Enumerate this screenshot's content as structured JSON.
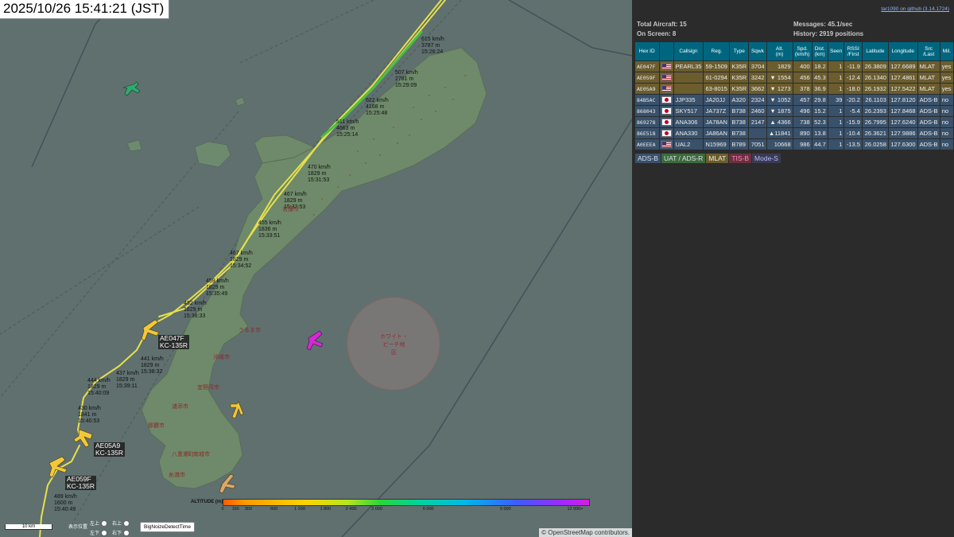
{
  "map": {
    "clock": "2025/10/26 15:41:21 (JST)",
    "attribution": "© OpenStreetMap contributors.",
    "scale_label": "10 km",
    "legend_title": "ALTITUDE (m)",
    "legend_ticks": [
      "0",
      "150",
      "300",
      "600",
      "1 200",
      "1 800",
      "2 400",
      "3 000",
      "6 000",
      "9 000",
      "12 000+"
    ],
    "zone_label": "ホワイト・\nビーチ地\n区",
    "place_labels": [
      "うるま市",
      "沖縄市",
      "宜野湾市",
      "浦添市",
      "那覇市",
      "糸満市",
      "南城市",
      "八重瀬町",
      "名護市"
    ],
    "position_label": "表示位置",
    "pos_options": [
      "左上",
      "右上",
      "左下",
      "右下"
    ],
    "time_button": "BigNoizeDetectTime",
    "track_labels": [
      "615 km/h\n3787 m\n15:26:24",
      "507 km/h\n2781 m\n15:29:09",
      "622 km/h\n4168 m\n15:25:48",
      "511 km/h\n4663 m\n15:25:14",
      "470 km/h\n1829 m\n15:31:53",
      "467 km/h\n1829 m\n15:32:53",
      "455 km/h\n1836 m\n15:33:51",
      "467 km/h\n1829 m\n15:34:52",
      "459 km/h\n1829 m\n15:35:49",
      "432 km/h\n1829 m\n15:36:33",
      "441 km/h\n1829 m\n15:38:32",
      "437 km/h\n1829 m\n15:39:11",
      "444 km/h\n1829 m\n15:40:09",
      "430 km/h\n1841 m\n15:40:53",
      "489 km/h\n1600 m\n15:40:49"
    ],
    "ac_tags": [
      "AE047F\nKC-135R",
      "AE05A9\nKC-135R",
      "AE059F\nKC-135R"
    ]
  },
  "panel": {
    "repo": "tar1090 on github (3.14.1724)",
    "total": "Total Aircraft: 15",
    "on_screen": "On Screen: 8",
    "messages": "Messages: 45.1/sec",
    "history": "History: 2919 positions",
    "headers": [
      "Hex ID",
      "",
      "Callsign",
      "Reg.",
      "Type",
      "Sqwk",
      "Alt.\n(m)",
      "Spd.\n(km/h)",
      "Dist.\n(km)",
      "Seen",
      "RSSI\n/First",
      "Latitude",
      "Longitude",
      "Src\n/Last",
      "Mil."
    ],
    "rows": [
      {
        "hex": "AE047F",
        "flag": "us",
        "callsign": "PEARL35",
        "reg": "59-1509",
        "type": "K35R",
        "sqwk": "3704",
        "alt": "1829",
        "spd": "400",
        "dist": "18.2",
        "seen": "1",
        "rssi": "-11.9",
        "lat": "26.3809",
        "lon": "127.6689",
        "src": "MLAT",
        "mil": "yes",
        "cls": "mlat"
      },
      {
        "hex": "AE059F",
        "flag": "us",
        "callsign": "",
        "reg": "61-0294",
        "type": "K35R",
        "sqwk": "3242",
        "alt": "▼ 1554",
        "spd": "456",
        "dist": "45.3",
        "seen": "1",
        "rssi": "-12.4",
        "lat": "26.1340",
        "lon": "127.4861",
        "src": "MLAT",
        "mil": "yes",
        "cls": "mlat"
      },
      {
        "hex": "AE05A9",
        "flag": "us",
        "callsign": "",
        "reg": "63-8015",
        "type": "K35R",
        "sqwk": "3662",
        "alt": "▼ 1273",
        "spd": "378",
        "dist": "36.9",
        "seen": "1",
        "rssi": "-18.0",
        "lat": "26.1932",
        "lon": "127.5422",
        "src": "MLAT",
        "mil": "yes",
        "cls": "mlat"
      },
      {
        "hex": "84B5AC",
        "flag": "jp",
        "callsign": "JJP335",
        "reg": "JA20JJ",
        "type": "A320",
        "sqwk": "2324",
        "alt": "▼ 1052",
        "spd": "457",
        "dist": "29.8",
        "seen": "39",
        "rssi": "-20.2",
        "lat": "26.1103",
        "lon": "127.8120",
        "src": "ADS-B",
        "mil": "no",
        "cls": "adsb"
      },
      {
        "hex": "868043",
        "flag": "jp",
        "callsign": "SKY517",
        "reg": "JA737Z",
        "type": "B738",
        "sqwk": "2460",
        "alt": "▼ 1875",
        "spd": "496",
        "dist": "15.2",
        "seen": "1",
        "rssi": "-5.4",
        "lat": "26.2393",
        "lon": "127.8468",
        "src": "ADS-B",
        "mil": "no",
        "cls": "adsb"
      },
      {
        "hex": "869278",
        "flag": "jp",
        "callsign": "ANA306",
        "reg": "JA78AN",
        "type": "B738",
        "sqwk": "2147",
        "alt": "▲ 4366",
        "spd": "738",
        "dist": "52.3",
        "seen": "1",
        "rssi": "-15.9",
        "lat": "26.7995",
        "lon": "127.6240",
        "src": "ADS-B",
        "mil": "no",
        "cls": "adsb"
      },
      {
        "hex": "86E518",
        "flag": "jp",
        "callsign": "ANA330",
        "reg": "JA86AN",
        "type": "B738",
        "sqwk": "",
        "alt": "▲11841",
        "spd": "890",
        "dist": "13.8",
        "seen": "1",
        "rssi": "-10.4",
        "lat": "26.3621",
        "lon": "127.9886",
        "src": "ADS-B",
        "mil": "no",
        "cls": "adsb"
      },
      {
        "hex": "A0EEEA",
        "flag": "us",
        "callsign": "UAL2",
        "reg": "N15969",
        "type": "B789",
        "sqwk": "7051",
        "alt": "10668",
        "spd": "986",
        "dist": "44.7",
        "seen": "1",
        "rssi": "-13.5",
        "lat": "26.0258",
        "lon": "127.6300",
        "src": "ADS-B",
        "mil": "no",
        "cls": "adsb"
      }
    ],
    "sources": [
      {
        "label": "ADS-B",
        "bg": "#39516a",
        "fg": "#dde"
      },
      {
        "label": "UAT / ADS-R",
        "bg": "#3c6b3c",
        "fg": "#dde"
      },
      {
        "label": "MLAT",
        "bg": "#6b5d2e",
        "fg": "#eed"
      },
      {
        "label": "TIS-B",
        "bg": "#6b3040",
        "fg": "#f8b"
      },
      {
        "label": "Mode-S",
        "bg": "#3a3a52",
        "fg": "#bbf"
      }
    ]
  }
}
